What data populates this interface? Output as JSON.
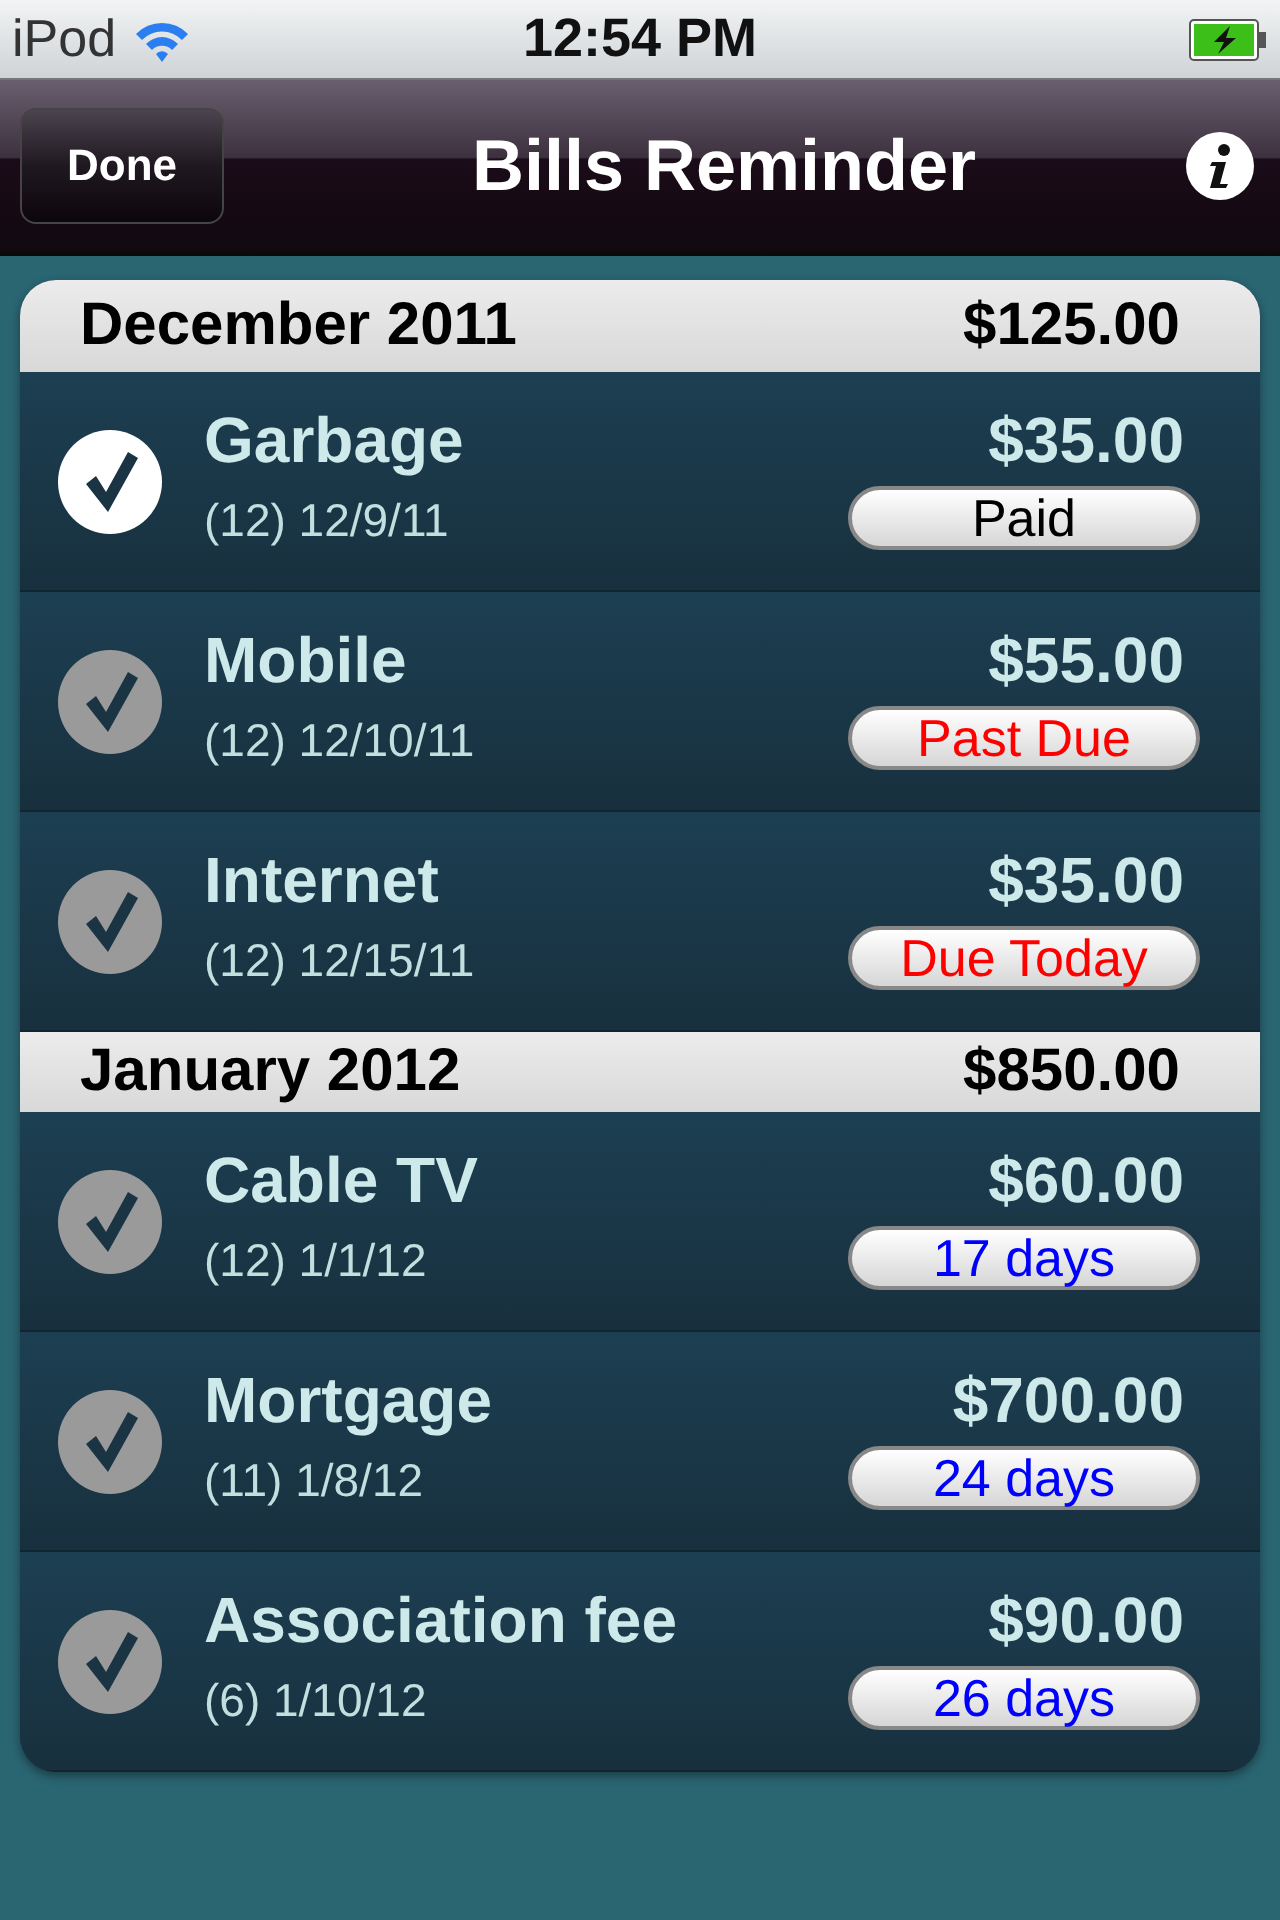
{
  "status_bar": {
    "carrier": "iPod",
    "time": "12:54 PM"
  },
  "nav_bar": {
    "left_button": "Done",
    "title": "Bills Reminder"
  },
  "sections": [
    {
      "title": "December 2011",
      "total": "$125.00",
      "bills": [
        {
          "name": "Garbage",
          "detail": "(12) 12/9/11",
          "amount": "$35.00",
          "checked": true,
          "status": {
            "kind": "paid",
            "text": "Paid"
          }
        },
        {
          "name": "Mobile",
          "detail": "(12) 12/10/11",
          "amount": "$55.00",
          "checked": false,
          "status": {
            "kind": "overdue",
            "text": "Past Due"
          }
        },
        {
          "name": "Internet",
          "detail": "(12) 12/15/11",
          "amount": "$35.00",
          "checked": false,
          "status": {
            "kind": "overdue",
            "text": "Due Today"
          }
        }
      ]
    },
    {
      "title": "January 2012",
      "total": "$850.00",
      "bills": [
        {
          "name": "Cable TV",
          "detail": "(12) 1/1/12",
          "amount": "$60.00",
          "checked": false,
          "status": {
            "kind": "upcoming",
            "text": "17 days"
          }
        },
        {
          "name": "Mortgage",
          "detail": "(11) 1/8/12",
          "amount": "$700.00",
          "checked": false,
          "status": {
            "kind": "upcoming",
            "text": "24 days"
          }
        },
        {
          "name": "Association fee",
          "detail": "(6) 1/10/12",
          "amount": "$90.00",
          "checked": false,
          "status": {
            "kind": "upcoming",
            "text": "26 days"
          }
        }
      ]
    }
  ]
}
